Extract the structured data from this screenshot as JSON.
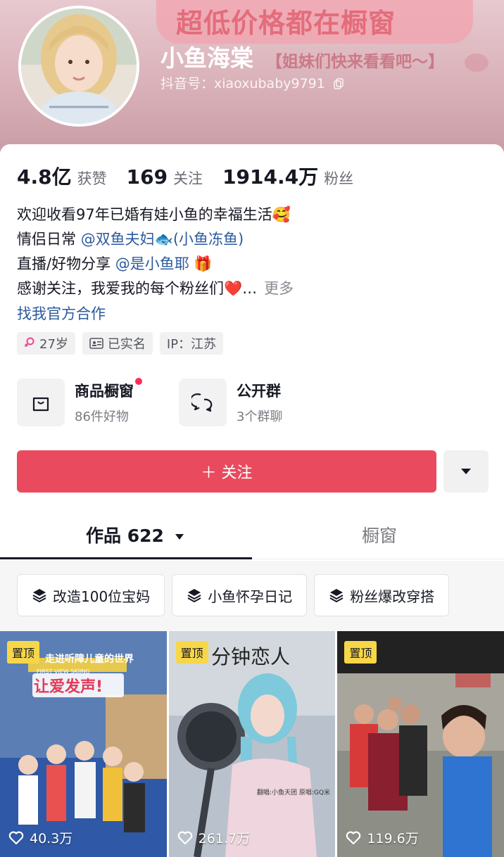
{
  "banner": {
    "headline": "超低价格都在橱窗",
    "subline": "【姐妹们快来看看吧～】"
  },
  "profile": {
    "nickname": "小鱼海棠",
    "douyin_id": "抖音号：xiaoxubaby9791"
  },
  "stats": [
    {
      "value": "4.8亿",
      "label": "获赞"
    },
    {
      "value": "169",
      "label": "关注"
    },
    {
      "value": "1914.4万",
      "label": "粉丝"
    }
  ],
  "bio": {
    "line1": "欢迎收看97年已婚有娃小鱼的幸福生活🥰",
    "line2_prefix": "情侣日常 ",
    "line2_mention": "@双鱼夫妇🐟(小鱼冻鱼)",
    "line3_prefix": "直播/好物分享 ",
    "line3_mention": "@是小鱼耶",
    "line3_suffix": " 🎁",
    "line4": "感谢关注，我爱我的每个粉丝们❤️…",
    "more": "更多",
    "link": "找我官方合作"
  },
  "tags": [
    {
      "icon": "female-icon",
      "text": "27岁"
    },
    {
      "icon": "id-card-icon",
      "text": "已实名"
    },
    {
      "icon": "",
      "text": "IP：江苏"
    }
  ],
  "entries": [
    {
      "icon": "shopping-bag-icon",
      "title": "商品橱窗",
      "sub": "86件好物",
      "has_dot": true
    },
    {
      "icon": "chat-bubbles-icon",
      "title": "公开群",
      "sub": "3个群聊",
      "has_dot": false
    }
  ],
  "follow_button": "＋ 关注",
  "tabs": {
    "works": "作品 622",
    "window": "橱窗"
  },
  "collections": [
    {
      "icon": "layers-icon",
      "text": "改造100位宝妈"
    },
    {
      "icon": "layers-icon",
      "text": "小鱼怀孕日记"
    },
    {
      "icon": "layers-icon",
      "text": "粉丝爆改穿搭"
    }
  ],
  "videos": [
    {
      "pin": "置顶",
      "likes": "40.3万",
      "overlay_top": "走进听障儿童的世界",
      "overlay_mid": "FIRST VIEW SKIING",
      "overlay_big": "让爱发声!"
    },
    {
      "pin": "置顶",
      "likes": "261.7万",
      "overlay_top": "分钟恋人",
      "overlay_note": "翻唱:小鱼天团 原唱:GQ米"
    },
    {
      "pin": "置顶",
      "likes": "119.6万"
    }
  ],
  "colors": {
    "accent": "#ea4a5e",
    "mention": "#2b5a9d",
    "pin": "#f7d749"
  }
}
